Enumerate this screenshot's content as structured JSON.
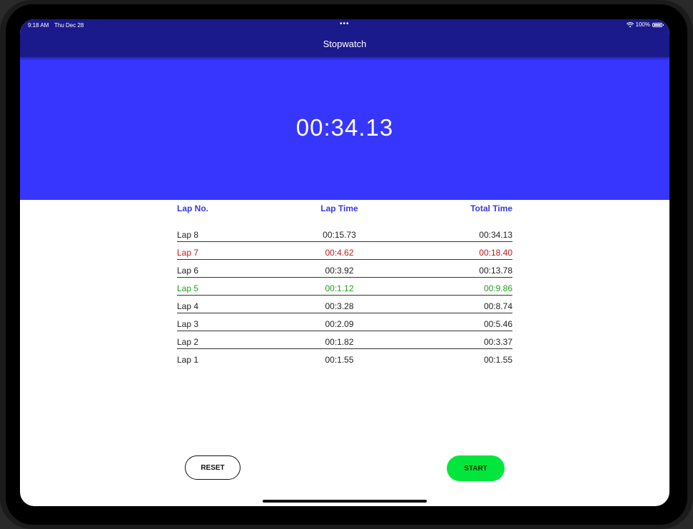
{
  "status_bar": {
    "time": "9:18 AM",
    "date": "Thu Dec 28",
    "dots": "•••",
    "battery_text": "100%",
    "icons": [
      "wifi-icon",
      "battery-icon"
    ]
  },
  "nav": {
    "title": "Stopwatch"
  },
  "timer": {
    "display": "00:34.13"
  },
  "colors": {
    "nav_background": "#1a1a8c",
    "timer_background": "#3636ff",
    "header_text": "#3a3ae0",
    "slowest_lap": "#c01818",
    "fastest_lap": "#1e9e1e",
    "start_button": "#00e63c"
  },
  "lap_table": {
    "headers": {
      "lap_no": "Lap No.",
      "lap_time": "Lap Time",
      "total_time": "Total Time"
    },
    "rows": [
      {
        "lap": "Lap 8",
        "lap_time": "00:15.73",
        "total": "00:34.13",
        "highlight": "none"
      },
      {
        "lap": "Lap 7",
        "lap_time": "00:4.62",
        "total": "00:18.40",
        "highlight": "red"
      },
      {
        "lap": "Lap 6",
        "lap_time": "00:3.92",
        "total": "00:13.78",
        "highlight": "none"
      },
      {
        "lap": "Lap 5",
        "lap_time": "00:1.12",
        "total": "00:9.86",
        "highlight": "green"
      },
      {
        "lap": "Lap 4",
        "lap_time": "00:3.28",
        "total": "00:8.74",
        "highlight": "none"
      },
      {
        "lap": "Lap 3",
        "lap_time": "00:2.09",
        "total": "00:5.46",
        "highlight": "none"
      },
      {
        "lap": "Lap 2",
        "lap_time": "00:1.82",
        "total": "00:3.37",
        "highlight": "none"
      },
      {
        "lap": "Lap 1",
        "lap_time": "00:1.55",
        "total": "00:1.55",
        "highlight": "none"
      }
    ]
  },
  "buttons": {
    "reset_label": "RESET",
    "start_label": "START"
  }
}
